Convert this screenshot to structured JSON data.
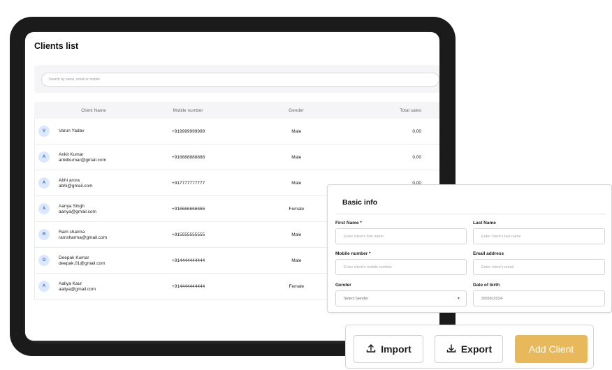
{
  "clients_list": {
    "title": "Clients list",
    "search_placeholder": "Search by name, email or mobile",
    "columns": {
      "name": "Client Name",
      "mobile": "Mobile number",
      "gender": "Gender",
      "sales": "Total sales"
    },
    "rows": [
      {
        "initial": "V",
        "name": "Varun Yadav",
        "email": "",
        "mobile": "+919999999999",
        "gender": "Male",
        "sales": "0.00"
      },
      {
        "initial": "A",
        "name": "Ankit Kumar",
        "email": "ankitkumar@gmail.com",
        "mobile": "+918888888888",
        "gender": "Male",
        "sales": "0.00"
      },
      {
        "initial": "A",
        "name": "Abhi arora",
        "email": "abhi@gmail.com",
        "mobile": "+917777777777",
        "gender": "Male",
        "sales": "0.00"
      },
      {
        "initial": "A",
        "name": "Aanya Singh",
        "email": "aanya@gmail.com",
        "mobile": "+916666666666",
        "gender": "Female",
        "sales": ""
      },
      {
        "initial": "R",
        "name": "Ram sharma",
        "email": "ramsharma@gmail.com",
        "mobile": "+915555555555",
        "gender": "Male",
        "sales": ""
      },
      {
        "initial": "D",
        "name": "Deepak Kumar",
        "email": "deepak.01@gmail.com",
        "mobile": "+914444444444",
        "gender": "Male",
        "sales": ""
      },
      {
        "initial": "A",
        "name": "Aaliya Kaur",
        "email": "aaliya@gmail.com",
        "mobile": "+914444444444",
        "gender": "Female",
        "sales": ""
      }
    ]
  },
  "basic_info": {
    "title": "Basic info",
    "first_name_label": "First Name *",
    "first_name_placeholder": "Enter client's first name",
    "last_name_label": "Last Name",
    "last_name_placeholder": "Enter client's last name",
    "mobile_label": "Mobile number *",
    "mobile_placeholder": "Enter client's mobile number",
    "email_label": "Email address",
    "email_placeholder": "Enter client's email",
    "gender_label": "Gender",
    "gender_value": "Select Gender",
    "dob_label": "Date of birth",
    "dob_value": "30/05/2024"
  },
  "actions": {
    "import_label": "Import",
    "export_label": "Export",
    "add_client_label": "Add Client"
  },
  "colors": {
    "accent": "#e8b95a",
    "avatar_bg": "#dbe8ff",
    "avatar_fg": "#3b6fd8"
  },
  "icons": {
    "import": "upload-icon",
    "export": "download-icon",
    "gender_select": "chevron-down-icon"
  }
}
